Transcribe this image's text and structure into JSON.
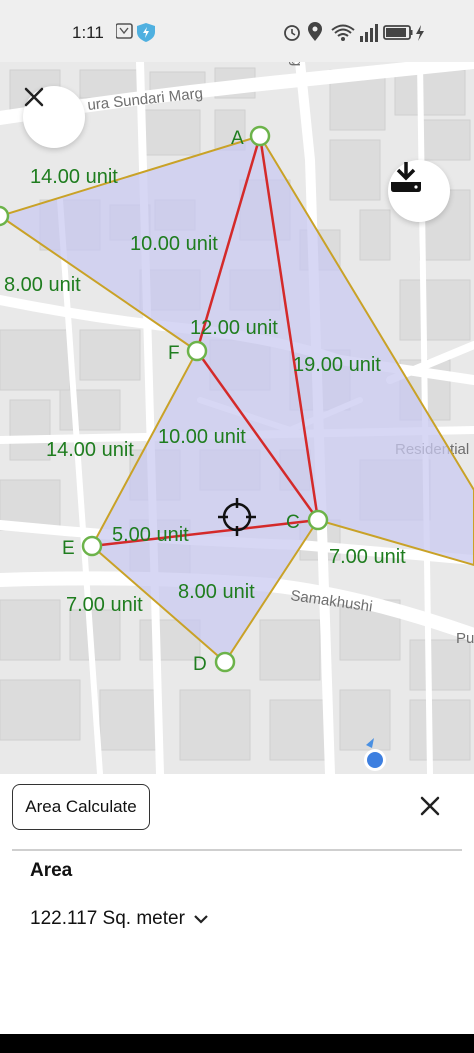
{
  "status_bar": {
    "time": "1:11",
    "icons": [
      "nfc-icon",
      "shield-icon",
      "alarm-icon",
      "location-icon",
      "wifi-icon",
      "signal-icon",
      "battery-icon",
      "charging-icon"
    ]
  },
  "map": {
    "street_labels": [
      "ura Sundari Marg",
      "Residential",
      "Samakhushi",
      "Pu",
      "g"
    ],
    "points": [
      {
        "label": "A"
      },
      {
        "label": "F"
      },
      {
        "label": "C"
      },
      {
        "label": "E"
      },
      {
        "label": "D"
      }
    ],
    "segment_labels": {
      "left_top": "14.00 unit",
      "left_edge": "8.00 unit",
      "a_f": "10.00 unit",
      "f_top": "12.00 unit",
      "a_c": "19.00 unit",
      "f_e": "14.00 unit",
      "f_c": "10.00 unit",
      "e_c": "5.00 unit",
      "c_right": "7.00 unit",
      "e_d": "7.00 unit",
      "c_d": "8.00 unit"
    },
    "colors": {
      "polygon_fill": "#c9c9f0",
      "outline": "#c9a227",
      "triangulation": "#d42a2a",
      "vertex": "#6cb34a",
      "label": "#1f7d1f"
    }
  },
  "panel": {
    "button_label": "Area Calculate",
    "area_title": "Area",
    "area_value": "122.117 Sq. meter"
  }
}
